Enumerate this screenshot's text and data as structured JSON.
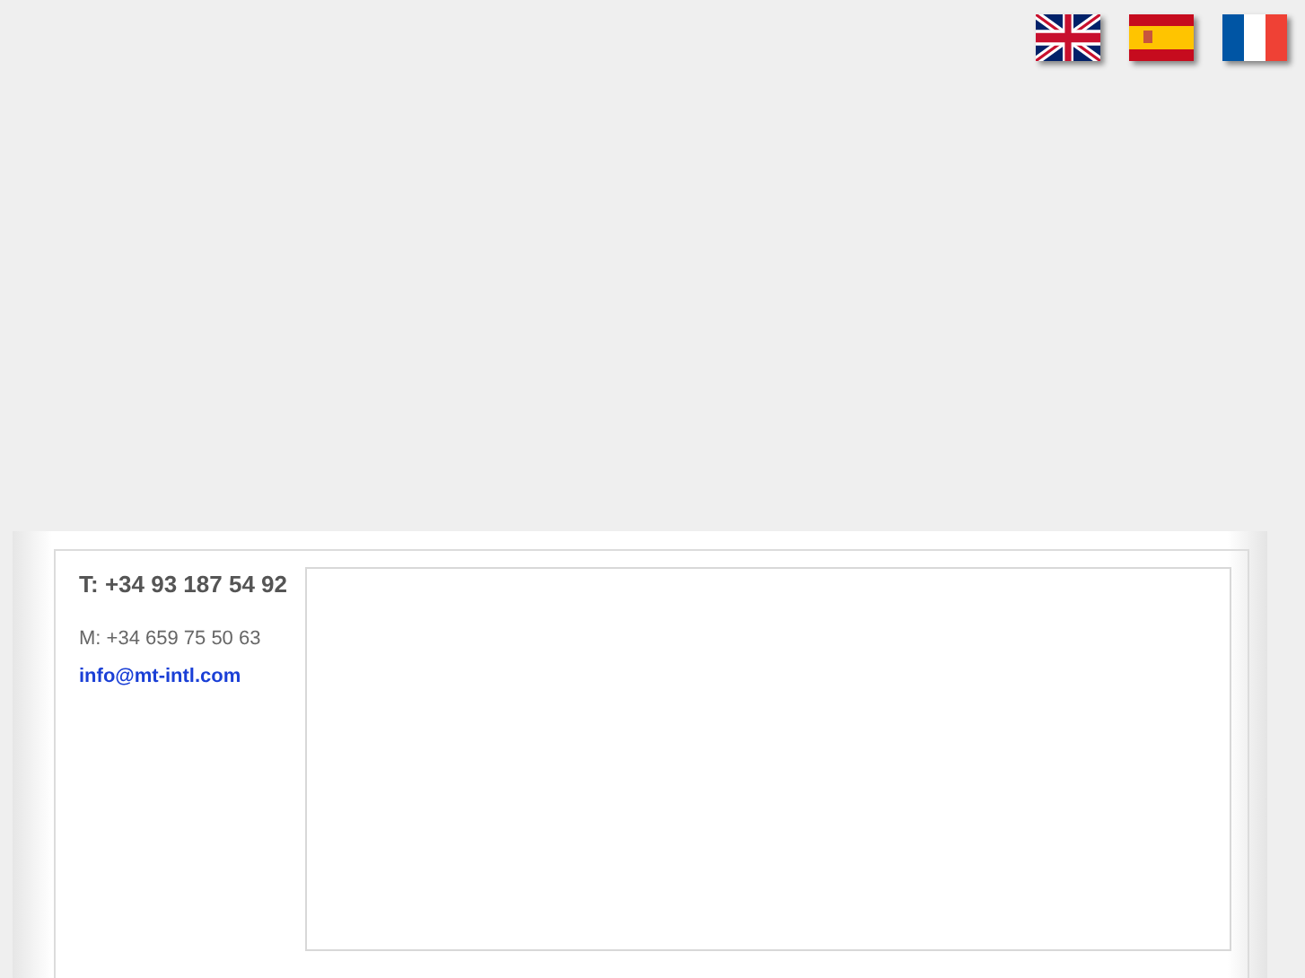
{
  "languages": [
    {
      "kind": "uk"
    },
    {
      "kind": "es"
    },
    {
      "kind": "fr"
    }
  ],
  "contact": {
    "phone": "T: +34 93 187 54 92",
    "mobile": "M: +34 659 75 50 63",
    "email": "info@mt-intl.com"
  }
}
